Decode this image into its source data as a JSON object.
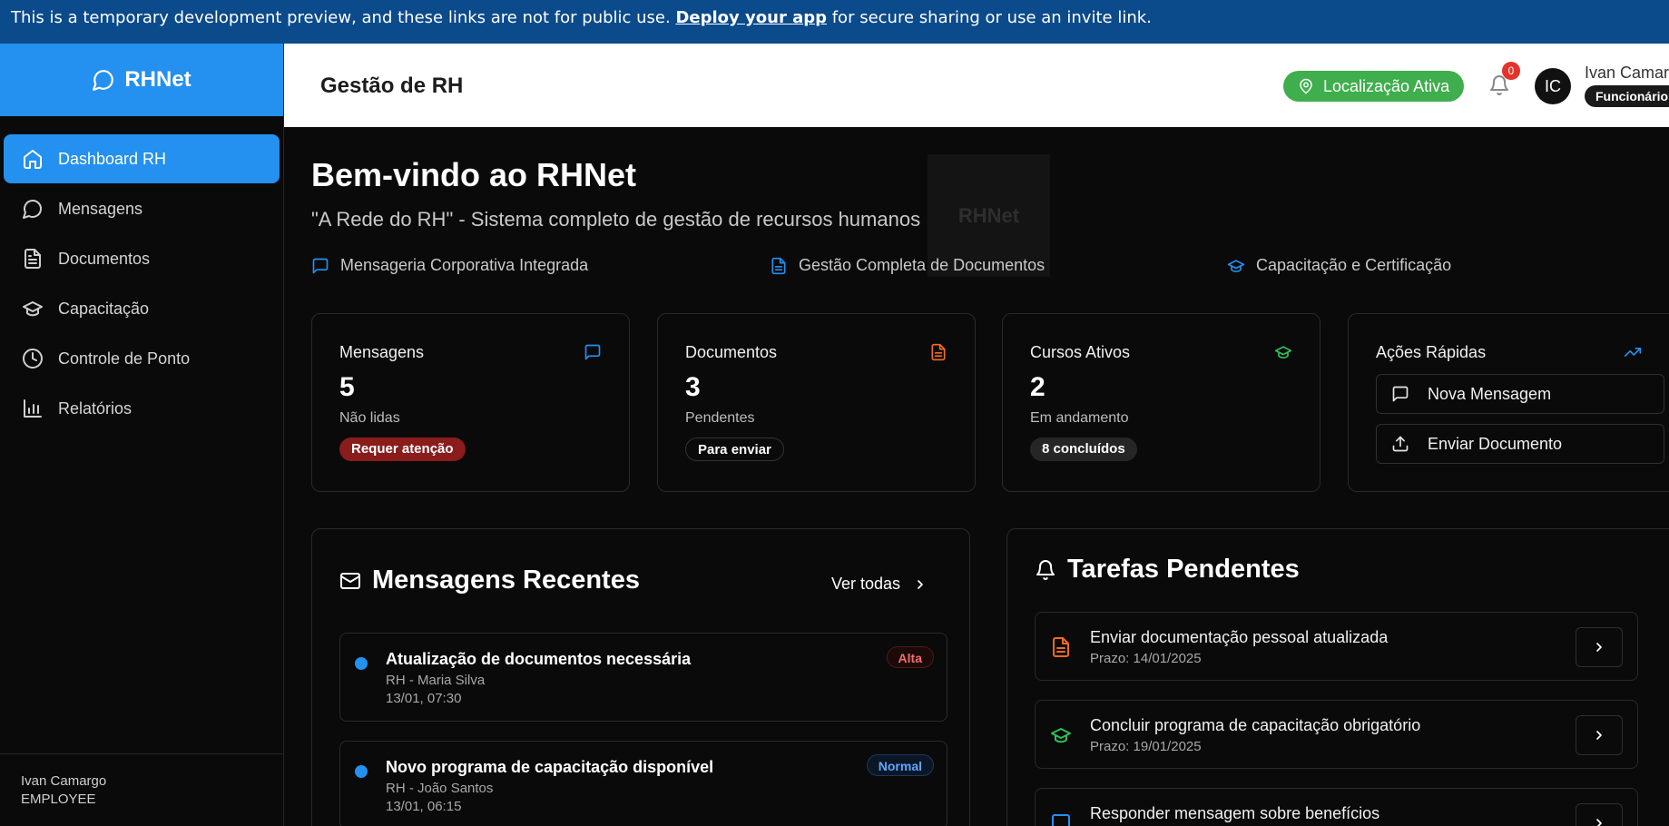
{
  "banner": {
    "text_before": "This is a temporary development preview, and these links are not for public use. ",
    "link": "Deploy your app",
    "text_after": " for secure sharing or use an invite link."
  },
  "sidebar": {
    "brand": "RHNet",
    "items": [
      {
        "label": "Dashboard RH",
        "icon": "home-icon",
        "active": true
      },
      {
        "label": "Mensagens",
        "icon": "message-circle-icon"
      },
      {
        "label": "Documentos",
        "icon": "file-text-icon"
      },
      {
        "label": "Capacitação",
        "icon": "graduation-cap-icon"
      },
      {
        "label": "Controle de Ponto",
        "icon": "clock-icon"
      },
      {
        "label": "Relatórios",
        "icon": "bar-chart-icon"
      }
    ],
    "footer": {
      "name": "Ivan Camargo",
      "role": "EMPLOYEE"
    }
  },
  "header": {
    "title": "Gestão de RH",
    "location_label": "Localização Ativa",
    "notification_count": "0",
    "avatar_initials": "IC",
    "user_name": "Ivan Camargo",
    "user_role": "Funcionário"
  },
  "welcome": {
    "title": "Bem-vindo ao RHNet",
    "subtitle": "\"A Rede do RH\" - Sistema completo de gestão de recursos humanos",
    "watermark": "RHNet",
    "features": [
      {
        "label": "Mensageria Corporativa Integrada",
        "icon": "message-square-icon"
      },
      {
        "label": "Gestão Completa de Documentos",
        "icon": "file-text-icon"
      },
      {
        "label": "Capacitação e Certificação",
        "icon": "graduation-cap-icon"
      }
    ]
  },
  "stats": [
    {
      "label": "Mensagens",
      "value": "5",
      "sub": "Não lidas",
      "badge": "Requer atenção",
      "icon": "message-square-icon",
      "icon_color": "#2490ef"
    },
    {
      "label": "Documentos",
      "value": "3",
      "sub": "Pendentes",
      "badge": "Para enviar",
      "icon": "file-text-icon",
      "icon_color": "#f26b1d"
    },
    {
      "label": "Cursos Ativos",
      "value": "2",
      "sub": "Em andamento",
      "badge": "8 concluídos",
      "icon": "graduation-cap-icon",
      "icon_color": "#2fbf5b"
    }
  ],
  "quick_actions": {
    "title": "Ações Rápidas",
    "icon": "trending-up-icon",
    "buttons": [
      {
        "label": "Nova Mensagem",
        "icon": "message-square-icon"
      },
      {
        "label": "Enviar Documento",
        "icon": "upload-icon"
      }
    ]
  },
  "recent_messages": {
    "title": "Mensagens Recentes",
    "view_all": "Ver todas",
    "items": [
      {
        "title": "Atualização de documentos necessária",
        "from": "RH - Maria Silva",
        "time": "13/01, 07:30",
        "priority": "Alta"
      },
      {
        "title": "Novo programa de capacitação disponível",
        "from": "RH - João Santos",
        "time": "13/01, 06:15",
        "priority": "Normal"
      }
    ]
  },
  "pending_tasks": {
    "title": "Tarefas Pendentes",
    "items": [
      {
        "title": "Enviar documentação pessoal atualizada",
        "due": "Prazo: 14/01/2025",
        "icon": "file-text-icon"
      },
      {
        "title": "Concluir programa de capacitação obrigatório",
        "due": "Prazo: 19/01/2025",
        "icon": "graduation-cap-icon"
      },
      {
        "title": "Responder mensagem sobre benefícios",
        "due": "",
        "icon": "message-square-icon"
      }
    ]
  },
  "colors": {
    "accent": "#2490ef",
    "success": "#3fae4c",
    "danger": "#e5322b",
    "orange": "#f26b1d"
  }
}
